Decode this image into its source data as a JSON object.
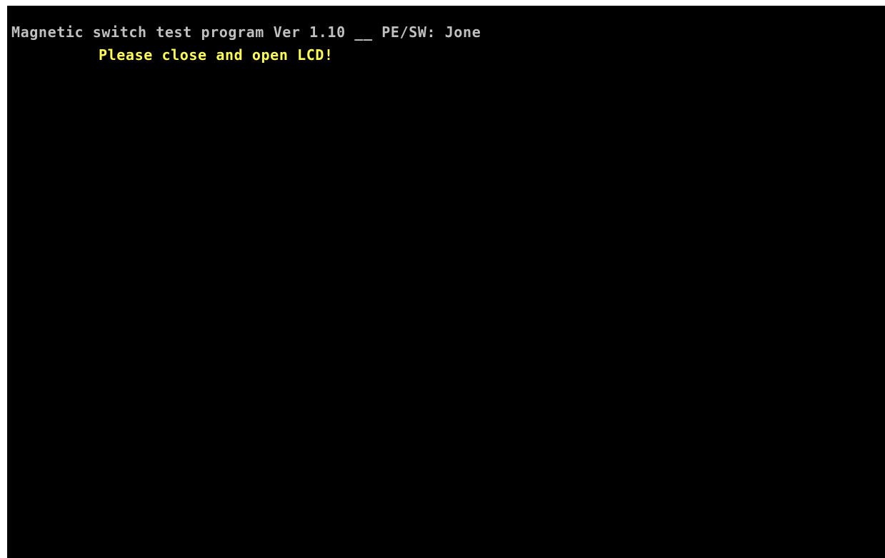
{
  "colors": {
    "background": "#000000",
    "header_text": "#c0c0c0",
    "prompt_text": "#ffff55"
  },
  "console": {
    "header": "Magnetic switch test program Ver 1.10 __ PE/SW: Jone",
    "prompt": "Please close and open LCD!"
  }
}
